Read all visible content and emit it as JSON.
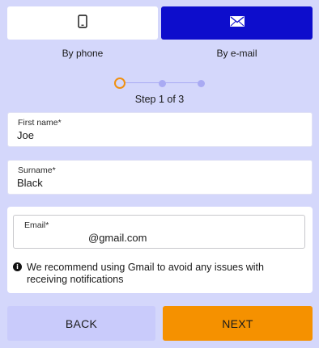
{
  "method_toggle": {
    "phone_label": "By phone",
    "email_label": "By e-mail",
    "selected": "email"
  },
  "stepper": {
    "text": "Step 1 of 3"
  },
  "form": {
    "first_name": {
      "label": "First name*",
      "value": "Joe"
    },
    "surname": {
      "label": "Surname*",
      "value": "Black"
    },
    "email": {
      "label": "Email*",
      "value": "@gmail.com"
    }
  },
  "notice": {
    "icon": "info-icon",
    "text": "We recommend using Gmail to avoid any issues with receiving notifications"
  },
  "actions": {
    "back_label": "BACK",
    "next_label": "NEXT"
  },
  "colors": {
    "background": "#d4d7fb",
    "selected_method": "#0d0dcc",
    "next_button": "#f59100",
    "back_button": "#c9cbfb",
    "step_active": "#f09010"
  }
}
